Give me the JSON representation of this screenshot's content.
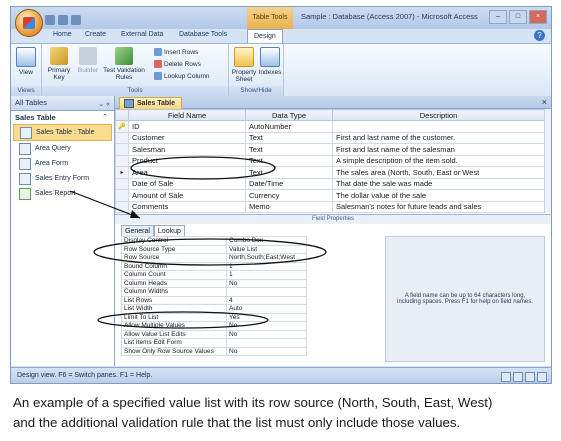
{
  "window": {
    "title": "Sample : Database (Access 2007) - Microsoft Access",
    "context_tab_label": "Table Tools"
  },
  "ribbon": {
    "tabs": [
      "Home",
      "Create",
      "External Data",
      "Database Tools",
      "Design"
    ],
    "active_tab": "Design",
    "groups": {
      "views": {
        "label": "Views",
        "view_button": "View"
      },
      "tools": {
        "label": "Tools",
        "primary_key": "Primary Key",
        "builder": "Builder",
        "test_validation_rules": "Test Validation Rules",
        "insert_rows": "Insert Rows",
        "delete_rows": "Delete Rows",
        "lookup_column": "Lookup Column"
      },
      "show_hide": {
        "label": "Show/Hide",
        "property_sheet": "Property Sheet",
        "indexes": "Indexes"
      }
    }
  },
  "nav_pane": {
    "header": "All Tables",
    "group": "Sales Table",
    "items": [
      {
        "label": "Sales Table : Table",
        "icon": "table-icon",
        "selected": true
      },
      {
        "label": "Area Query",
        "icon": "query-icon",
        "selected": false
      },
      {
        "label": "Area Form",
        "icon": "form-icon",
        "selected": false
      },
      {
        "label": "Sales Entry Form",
        "icon": "form-icon",
        "selected": false
      },
      {
        "label": "Sales Report",
        "icon": "report-icon",
        "selected": false
      }
    ]
  },
  "document": {
    "tab_label": "Sales Table",
    "columns": [
      "Field Name",
      "Data Type",
      "Description"
    ],
    "rows": [
      {
        "name": "ID",
        "type": "AutoNumber",
        "description": "",
        "key": true
      },
      {
        "name": "Customer",
        "type": "Text",
        "description": "First and last name of the customer."
      },
      {
        "name": "Salesman",
        "type": "Text",
        "description": "First and last name of the salesman"
      },
      {
        "name": "Product",
        "type": "Text",
        "description": "A simple description of the item sold."
      },
      {
        "name": "Area",
        "type": "Text",
        "description": "The sales area (North, South, East or West"
      },
      {
        "name": "Date of Sale",
        "type": "Date/Time",
        "description": "That date the sale was made"
      },
      {
        "name": "Amount of Sale",
        "type": "Currency",
        "description": "The dollar value of the sale"
      },
      {
        "name": "Comments",
        "type": "Memo",
        "description": "Salesman's notes for future leads and sales"
      }
    ],
    "field_properties_label": "Field Properties",
    "property_tabs": [
      "General",
      "Lookup"
    ],
    "active_property_tab": "Lookup",
    "properties": [
      {
        "key": "Display Control",
        "value": "Combo Box"
      },
      {
        "key": "Row Source Type",
        "value": "Value List"
      },
      {
        "key": "Row Source",
        "value": "North;South;East;West"
      },
      {
        "key": "Bound Column",
        "value": "1"
      },
      {
        "key": "Column Count",
        "value": "1"
      },
      {
        "key": "Column Heads",
        "value": "No"
      },
      {
        "key": "Column Widths",
        "value": ""
      },
      {
        "key": "List Rows",
        "value": "4"
      },
      {
        "key": "List Width",
        "value": "Auto"
      },
      {
        "key": "Limit To List",
        "value": "Yes"
      },
      {
        "key": "Allow Multiple Values",
        "value": "No"
      },
      {
        "key": "Allow Value List Edits",
        "value": "No"
      },
      {
        "key": "List Items Edit Form",
        "value": ""
      },
      {
        "key": "Show Only Row Source Values",
        "value": "No"
      }
    ],
    "help_text": "A field name can be up to 64 characters long, including spaces. Press F1 for help on field names."
  },
  "status_bar": {
    "text": "Design view.  F6 = Switch panes.  F1 = Help."
  },
  "caption": {
    "line1": "An example of a specified value list with its row source (North, South, East, West)",
    "line2": "and the additional validation rule that the list must only include those values."
  },
  "colors": {
    "ribbon_blue": "#d5e3f4",
    "selected_yellow": "#f9dc8f",
    "context_orange": "#e8b24d"
  }
}
